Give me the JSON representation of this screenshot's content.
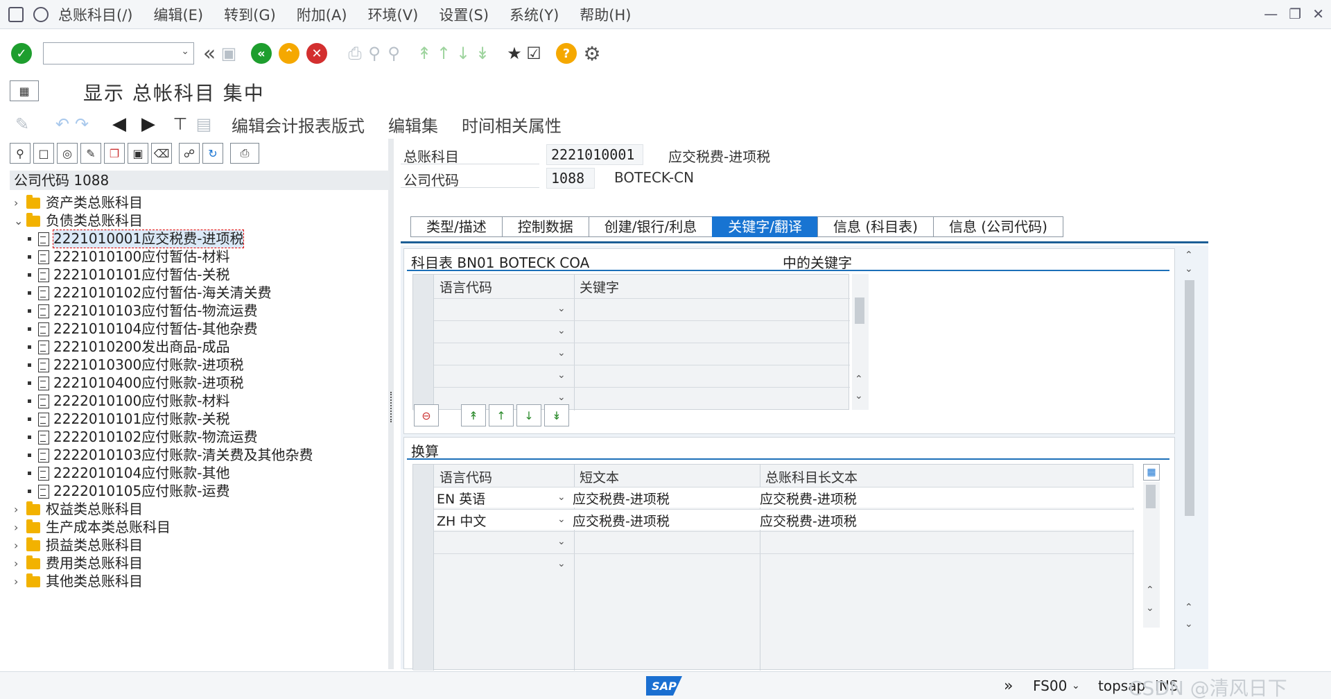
{
  "menu": {
    "items": [
      "总账科目(/)",
      "编辑(E)",
      "转到(G)",
      "附加(A)",
      "环境(V)",
      "设置(S)",
      "系统(Y)",
      "帮助(H)"
    ]
  },
  "title": "显示 总帐科目 集中",
  "app_toolbar": {
    "edit_layout": "编辑会计报表版式",
    "edit_set": "编辑集",
    "time_attr": "时间相关属性"
  },
  "tree": {
    "header": "公司代码 1088",
    "folders_top": [
      {
        "label": "资产类总账科目",
        "expanded": false
      },
      {
        "label": "负债类总账科目",
        "expanded": true
      }
    ],
    "accounts": [
      "2221010001应交税费-进项税",
      "2221010100应付暂估-材料",
      "2221010101应付暂估-关税",
      "2221010102应付暂估-海关清关费",
      "2221010103应付暂估-物流运费",
      "2221010104应付暂估-其他杂费",
      "2221010200发出商品-成品",
      "2221010300应付账款-进项税",
      "2221010400应付账款-进项税",
      "2222010100应付账款-材料",
      "2222010101应付账款-关税",
      "2222010102应付账款-物流运费",
      "2222010103应付账款-清关费及其他杂费",
      "2222010104应付账款-其他",
      "2222010105应付账款-运费"
    ],
    "folders_bottom": [
      "权益类总账科目",
      "生产成本类总账科目",
      "损益类总账科目",
      "费用类总账科目",
      "其他类总账科目"
    ]
  },
  "header_fields": {
    "gl_label": "总账科目",
    "gl_value": "2221010001",
    "gl_desc": "应交税费-进项税",
    "cc_label": "公司代码",
    "cc_value": "1088",
    "cc_desc": "BOTECK-CN"
  },
  "tabs": [
    "类型/描述",
    "控制数据",
    "创建/银行/利息",
    "关键字/翻译",
    "信息 (科目表)",
    "信息 (公司代码)"
  ],
  "active_tab": "关键字/翻译",
  "keywords_section": {
    "title_left": "科目表 BN01 BOTECK COA",
    "title_right": "中的关键字",
    "col_lang": "语言代码",
    "col_keyword": "关键字"
  },
  "translation_section": {
    "title": "换算",
    "col_lang": "语言代码",
    "col_short": "短文本",
    "col_long": "总账科目长文本",
    "rows": [
      {
        "lang": "EN 英语",
        "short": "应交税费-进项税",
        "long": "应交税费-进项税"
      },
      {
        "lang": "ZH 中文",
        "short": "应交税费-进项税",
        "long": "应交税费-进项税"
      }
    ]
  },
  "status": {
    "tcode": "FS00",
    "server": "topsap",
    "mode": "INS",
    "watermark": "CSDN @清风日下"
  },
  "colors": {
    "accent": "#1874d2",
    "ok": "#1e9e2e",
    "cancel": "#d32f2f",
    "exit": "#f5a800"
  }
}
